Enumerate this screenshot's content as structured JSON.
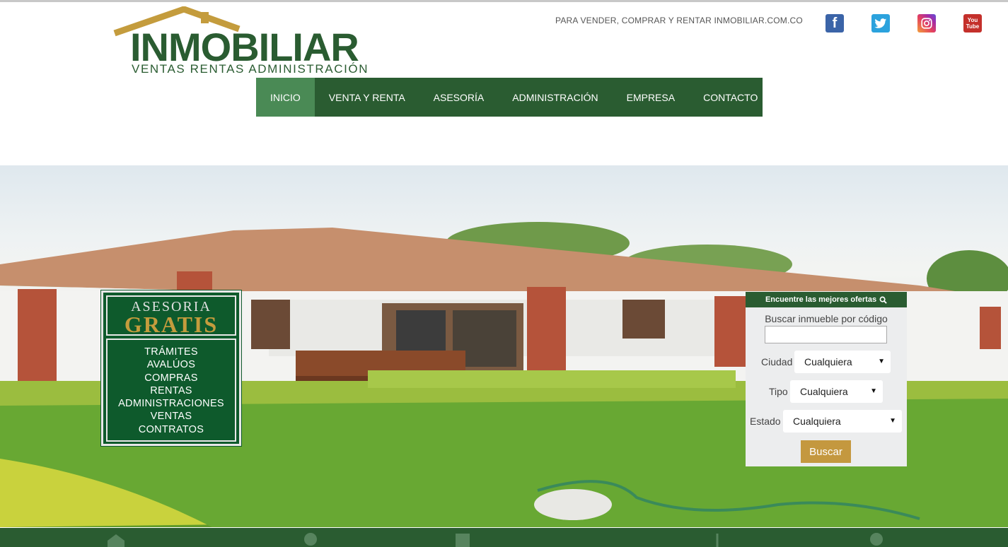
{
  "header": {
    "logo_text": "INMOBILIAR",
    "logo_subtitle": "VENTAS RENTAS ADMINISTRACIÓN",
    "tagline": "PARA VENDER, COMPRAR Y RENTAR INMOBILIAR.COM.CO",
    "social": [
      {
        "name": "facebook",
        "icon": "facebook-icon",
        "glyph": "f"
      },
      {
        "name": "twitter",
        "icon": "twitter-icon"
      },
      {
        "name": "instagram",
        "icon": "instagram-icon"
      },
      {
        "name": "youtube",
        "icon": "youtube-icon",
        "glyph": "You Tube"
      }
    ]
  },
  "nav": {
    "items": [
      {
        "label": "INICIO",
        "active": true
      },
      {
        "label": "VENTA Y RENTA"
      },
      {
        "label": "ASESORÍA"
      },
      {
        "label": "ADMINISTRACIÓN"
      },
      {
        "label": "EMPRESA"
      },
      {
        "label": "CONTACTO"
      }
    ]
  },
  "promo": {
    "title_top": "ASESORIA",
    "title_bottom": "GRATIS",
    "items": [
      "TRÁMITES",
      "AVALÚOS",
      "COMPRAS",
      "RENTAS",
      "ADMINISTRACIONES",
      "VENTAS",
      "CONTRATOS"
    ]
  },
  "search": {
    "header": "Encuentre las mejores ofertas",
    "code_label": "Buscar inmueble por código",
    "code_value": "",
    "city_label": "Ciudad",
    "city_value": "Cualquiera",
    "type_label": "Tipo",
    "type_value": "Cualquiera",
    "state_label": "Estado",
    "state_value": "Cualquiera",
    "button": "Buscar"
  },
  "colors": {
    "brand_green": "#2a5c31",
    "active_nav": "#4a8a55",
    "gold": "#c4983f",
    "promo_green": "#0e5a2c"
  }
}
